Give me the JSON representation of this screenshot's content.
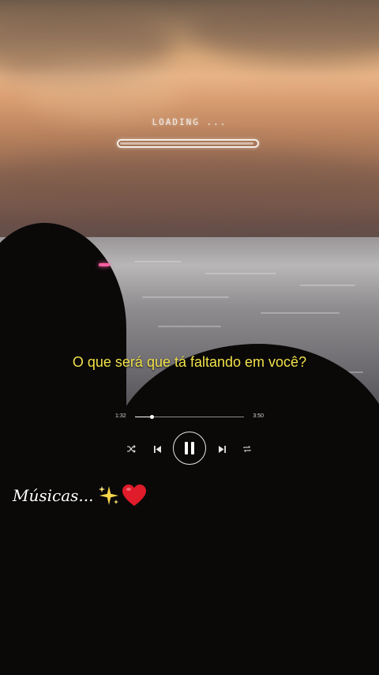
{
  "loading": {
    "label": "LOADING ...",
    "progress": 0.98
  },
  "lyric": "O que será que tá faltando em você?",
  "player": {
    "current_time": "1:32",
    "total_time": "3:50",
    "progress": 0.15,
    "state": "playing",
    "icons": {
      "shuffle": "shuffle-icon",
      "previous": "previous-icon",
      "pause": "pause-icon",
      "next": "next-icon",
      "repeat": "repeat-icon"
    }
  },
  "caption": {
    "text": "Músicas...",
    "emoji": [
      "sparkles-icon",
      "red-heart-icon"
    ]
  },
  "colors": {
    "lyric": "#f2e24a",
    "accent_dot": "#ff5fa0",
    "heart": "#e01b2a",
    "sparkle": "#f7d64a"
  }
}
